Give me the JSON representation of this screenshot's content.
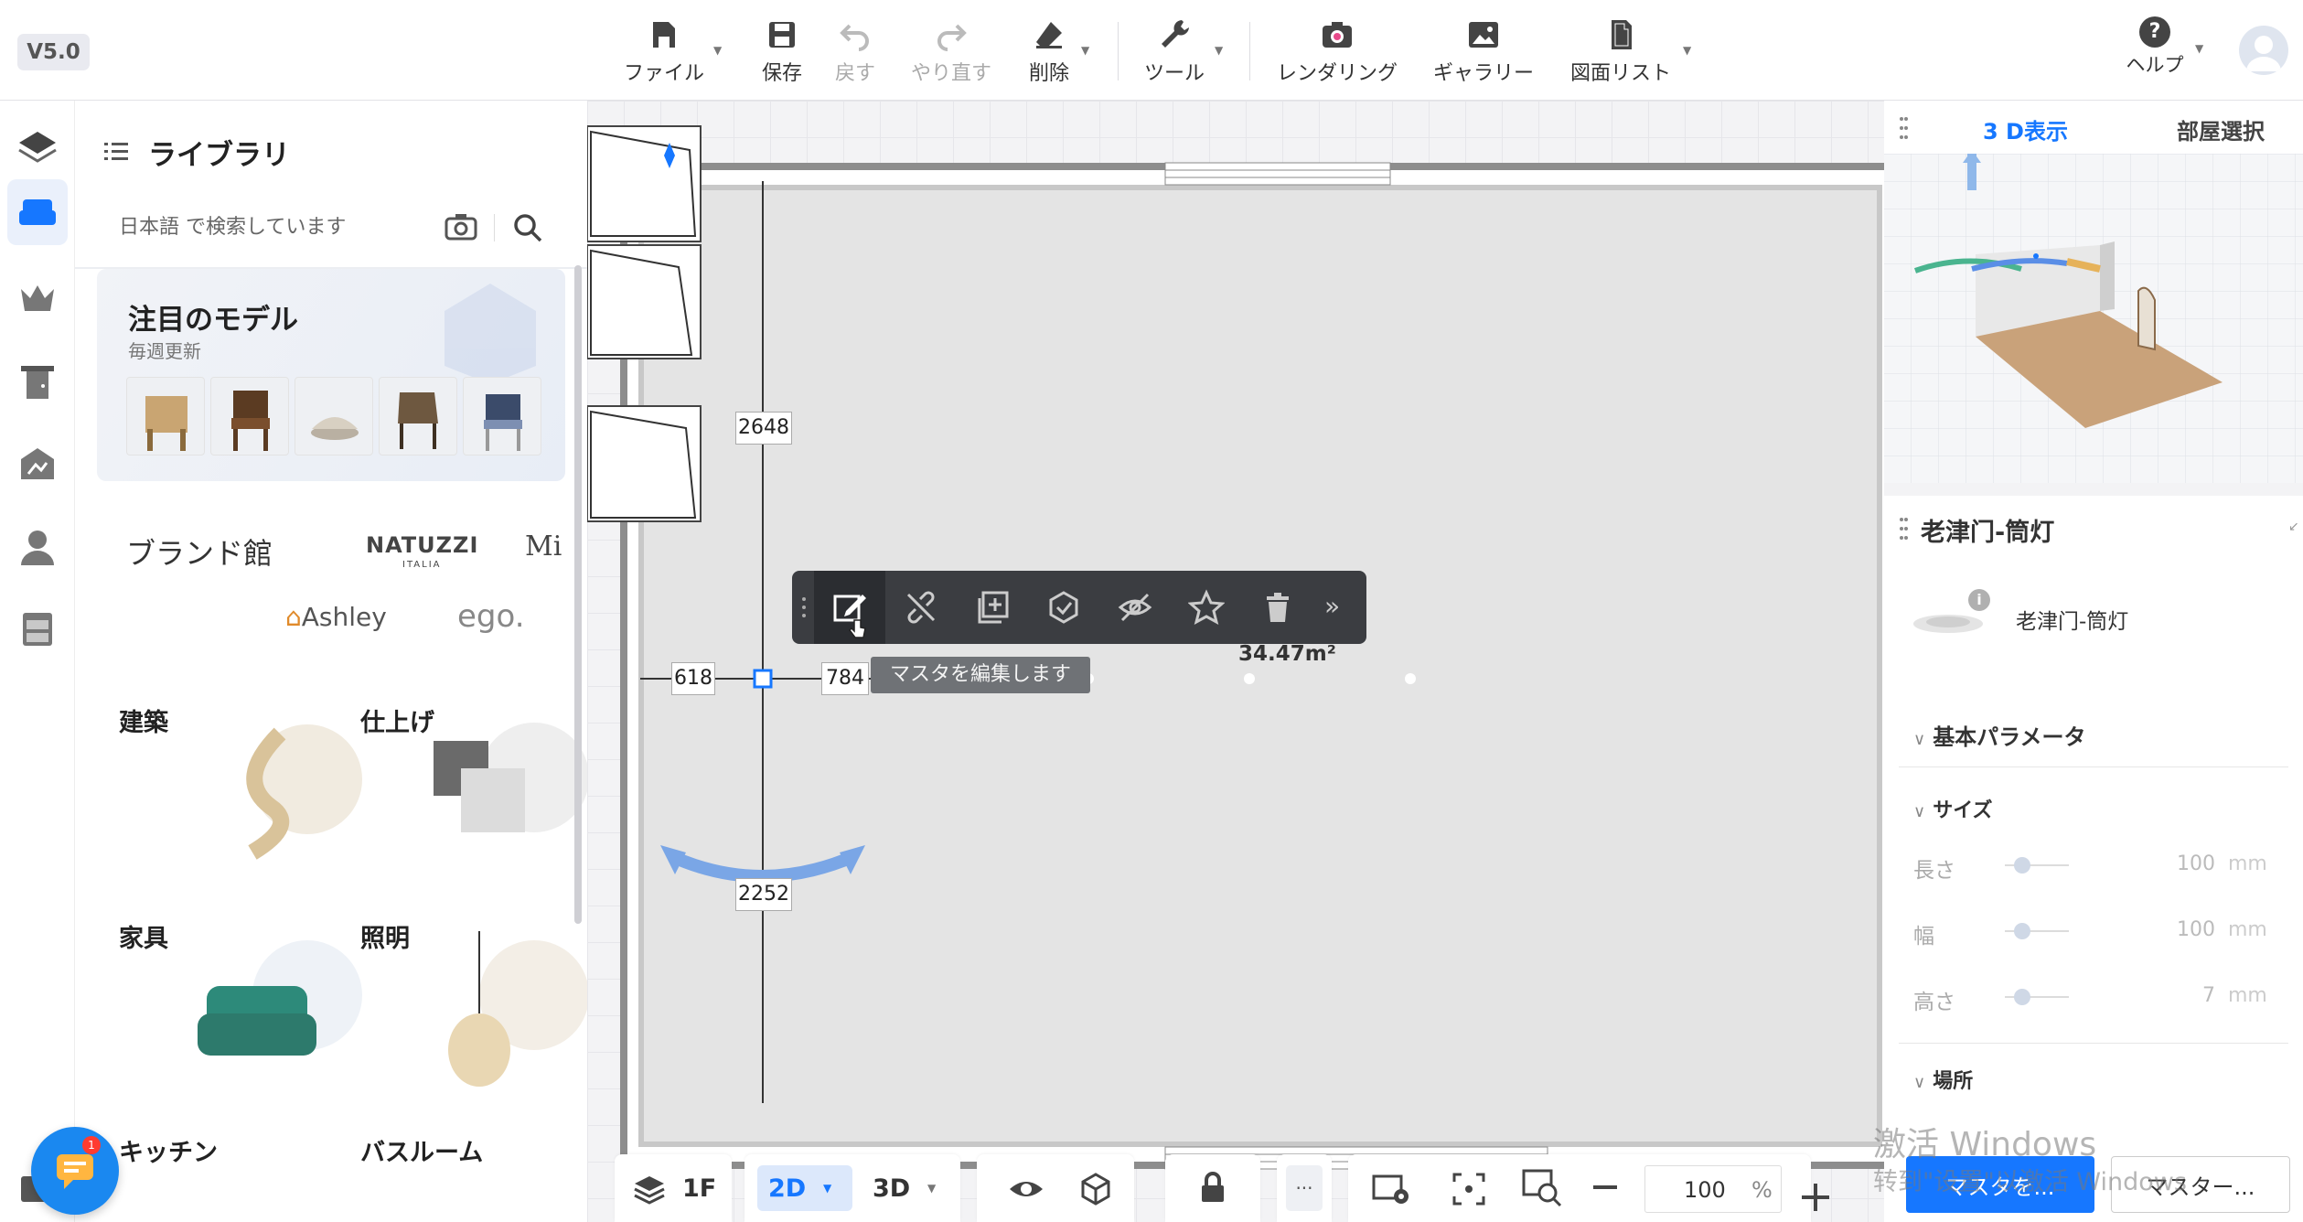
{
  "app": {
    "version": "V5.0"
  },
  "toolbar": {
    "file": "ファイル",
    "save": "保存",
    "undo": "戻す",
    "redo": "やり直す",
    "delete": "削除",
    "tools": "ツール",
    "rendering": "レンダリング",
    "gallery": "ギャラリー",
    "floorplan_list": "図面リスト",
    "help": "ヘルプ"
  },
  "library": {
    "title": "ライブラリ",
    "search_placeholder": "日本語 で検索しています",
    "featured": {
      "title": "注目のモデル",
      "subtitle": "毎週更新"
    },
    "brand_title": "ブランド館",
    "brands": [
      "NATUZZI",
      "ITALIA",
      "Mi",
      "Ashley",
      "ego."
    ],
    "categories": [
      "建築",
      "仕上げ",
      "家具",
      "照明",
      "キッチン",
      "バスルーム"
    ]
  },
  "canvas": {
    "dim_vertical_top": "2648",
    "dim_vertical_bottom": "2252",
    "dim_left": "618",
    "dim_right": "784",
    "area": "34.47m²",
    "tooltip": "マスタを編集します"
  },
  "bottom_bar": {
    "floor": "1F",
    "mode_2d": "2D",
    "mode_3d": "3D",
    "more": "···",
    "zoom_value": "100",
    "zoom_unit": "%"
  },
  "right_panel": {
    "tab_3d": "3 D表示",
    "tab_room_select": "部屋選択",
    "props_title": "老津门-筒灯",
    "item_name": "老津门-筒灯",
    "section_basic": "基本パラメータ",
    "section_size": "サイズ",
    "params": [
      {
        "label": "長さ",
        "value": "100",
        "unit": "mm"
      },
      {
        "label": "幅",
        "value": "100",
        "unit": "mm"
      },
      {
        "label": "高さ",
        "value": "7",
        "unit": "mm"
      }
    ],
    "section_location": "場所",
    "master_btn_1": "マスタを...",
    "master_btn_2": "マスター..."
  },
  "watermark": {
    "line1": "激活 Windows",
    "line2": "转到\"设置\"以激活 Windows"
  },
  "colors": {
    "accent": "#1677ff",
    "toolbar_dark": "#3b3d41",
    "wall": "#8d8d8d",
    "floor": "#e4e4e4"
  }
}
